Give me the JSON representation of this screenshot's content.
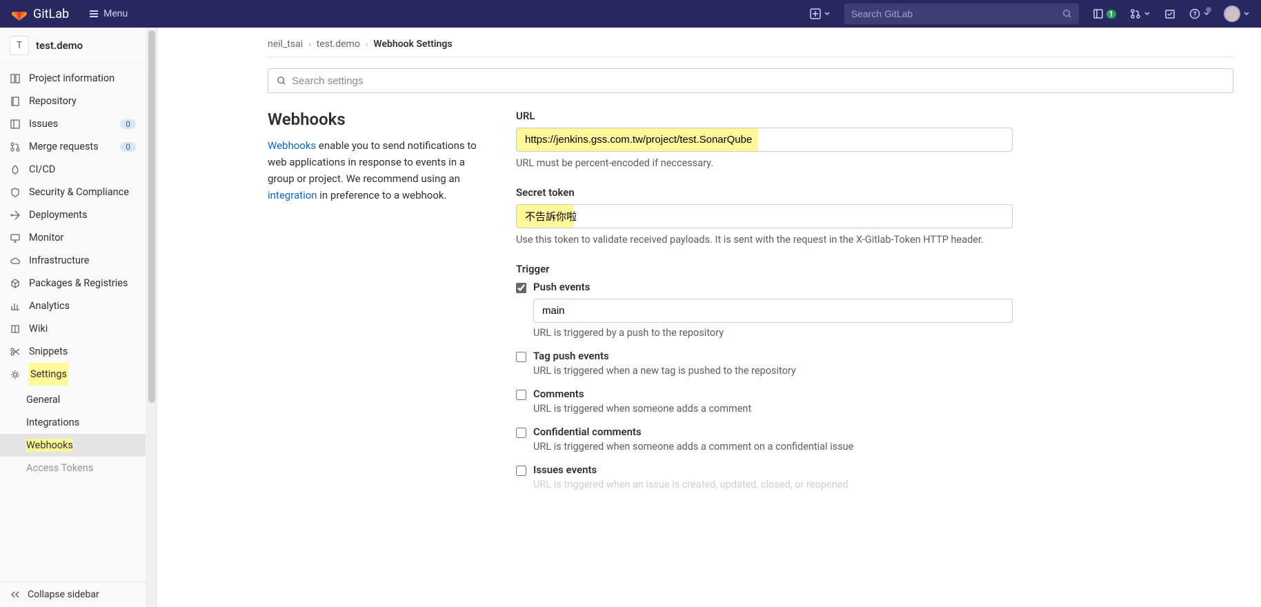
{
  "topbar": {
    "brand": "GitLab",
    "menu_label": "Menu",
    "search_placeholder": "Search GitLab",
    "issues_badge": "1"
  },
  "project": {
    "avatar_letter": "T",
    "name": "test.demo"
  },
  "sidebar": {
    "items": [
      {
        "label": "Project information"
      },
      {
        "label": "Repository"
      },
      {
        "label": "Issues",
        "badge": "0"
      },
      {
        "label": "Merge requests",
        "badge": "0"
      },
      {
        "label": "CI/CD"
      },
      {
        "label": "Security & Compliance"
      },
      {
        "label": "Deployments"
      },
      {
        "label": "Monitor"
      },
      {
        "label": "Infrastructure"
      },
      {
        "label": "Packages & Registries"
      },
      {
        "label": "Analytics"
      },
      {
        "label": "Wiki"
      },
      {
        "label": "Snippets"
      },
      {
        "label": "Settings"
      }
    ],
    "subitems": [
      {
        "label": "General"
      },
      {
        "label": "Integrations"
      },
      {
        "label": "Webhooks"
      },
      {
        "label": "Access Tokens"
      }
    ],
    "collapse_label": "Collapse sidebar"
  },
  "breadcrumb": {
    "items": [
      "neil_tsai",
      "test.demo"
    ],
    "current": "Webhook Settings"
  },
  "search_settings_placeholder": "Search settings",
  "webhooks": {
    "title": "Webhooks",
    "desc_link1": "Webhooks",
    "desc_part1": " enable you to send notifications to web applications in response to events in a group or project. We recommend using an ",
    "desc_link2": "integration",
    "desc_part2": " in preference to a webhook.",
    "url_label": "URL",
    "url_value": "https://jenkins.gss.com.tw/project/test.SonarQube",
    "url_help": "URL must be percent-encoded if neccessary.",
    "token_label": "Secret token",
    "token_value": "不告訴你啦",
    "token_help": "Use this token to validate received payloads. It is sent with the request in the X-Gitlab-Token HTTP header.",
    "trigger_label": "Trigger",
    "triggers": [
      {
        "label": "Push events",
        "checked": true,
        "input_value": "main",
        "help": "URL is triggered by a push to the repository"
      },
      {
        "label": "Tag push events",
        "checked": false,
        "help": "URL is triggered when a new tag is pushed to the repository"
      },
      {
        "label": "Comments",
        "checked": false,
        "help": "URL is triggered when someone adds a comment"
      },
      {
        "label": "Confidential comments",
        "checked": false,
        "help": "URL is triggered when someone adds a comment on a confidential issue"
      },
      {
        "label": "Issues events",
        "checked": false,
        "help": "URL is triggered when an issue is created, updated, closed, or reopened"
      }
    ]
  }
}
